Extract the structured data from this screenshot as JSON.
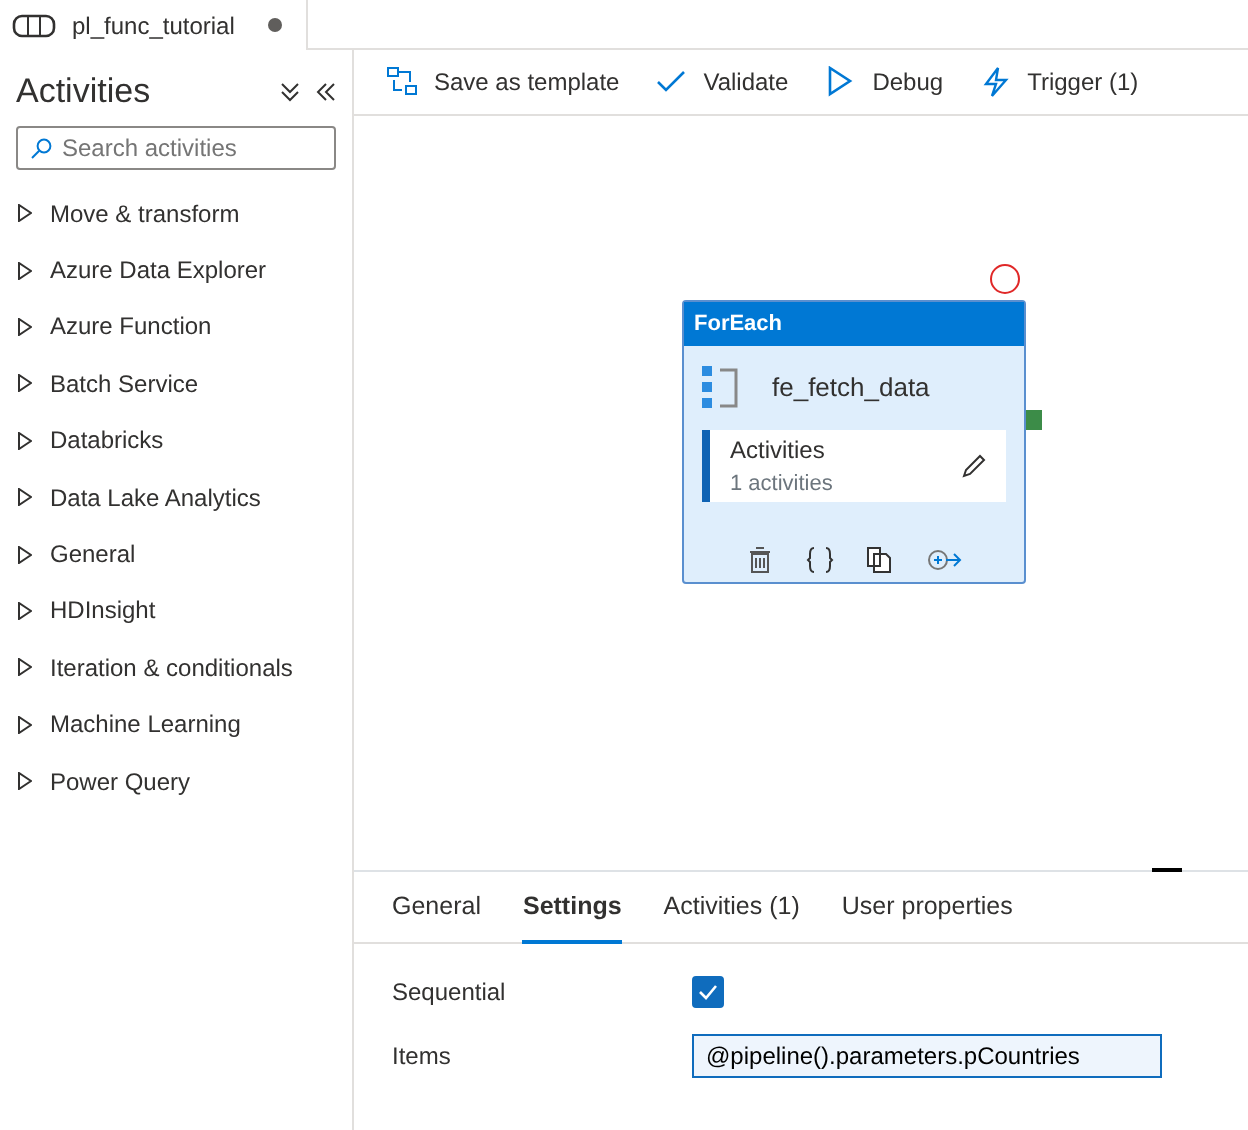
{
  "file_tab": {
    "title": "pl_func_tutorial",
    "unsaved": true
  },
  "sidebar": {
    "title": "Activities",
    "search": {
      "placeholder": "Search activities"
    },
    "groups": [
      {
        "label": "Move & transform",
        "expanded": false
      },
      {
        "label": "Azure Data Explorer",
        "expanded": false
      },
      {
        "label": "Azure Function",
        "expanded": false
      },
      {
        "label": "Batch Service",
        "expanded": false
      },
      {
        "label": "Databricks",
        "expanded": false
      },
      {
        "label": "Data Lake Analytics",
        "expanded": false
      },
      {
        "label": "General",
        "expanded": false
      },
      {
        "label": "HDInsight",
        "expanded": false
      },
      {
        "label": "Iteration & conditionals",
        "expanded": false
      },
      {
        "label": "Machine Learning",
        "expanded": false
      },
      {
        "label": "Power Query",
        "expanded": false
      }
    ]
  },
  "toolbar": [
    {
      "kind": "template",
      "label": "Save as template"
    },
    {
      "kind": "validate",
      "label": "Validate"
    },
    {
      "kind": "debug",
      "label": "Debug"
    },
    {
      "kind": "trigger",
      "label": "Trigger (1)"
    }
  ],
  "activity": {
    "type": "ForEach",
    "name": "fe_fetch_data",
    "inner_title": "Activities",
    "inner_count": "1 activities"
  },
  "properties": {
    "tabs": [
      {
        "label": "General",
        "selected": false
      },
      {
        "label": "Settings",
        "selected": true
      },
      {
        "label": "Activities (1)",
        "selected": false
      },
      {
        "label": "User properties",
        "selected": false
      }
    ],
    "fields": [
      {
        "kind": "checkbox",
        "label": "Sequential",
        "checked": true
      },
      {
        "kind": "text",
        "label": "Items",
        "value": "@pipeline().parameters.pCountries"
      }
    ]
  }
}
